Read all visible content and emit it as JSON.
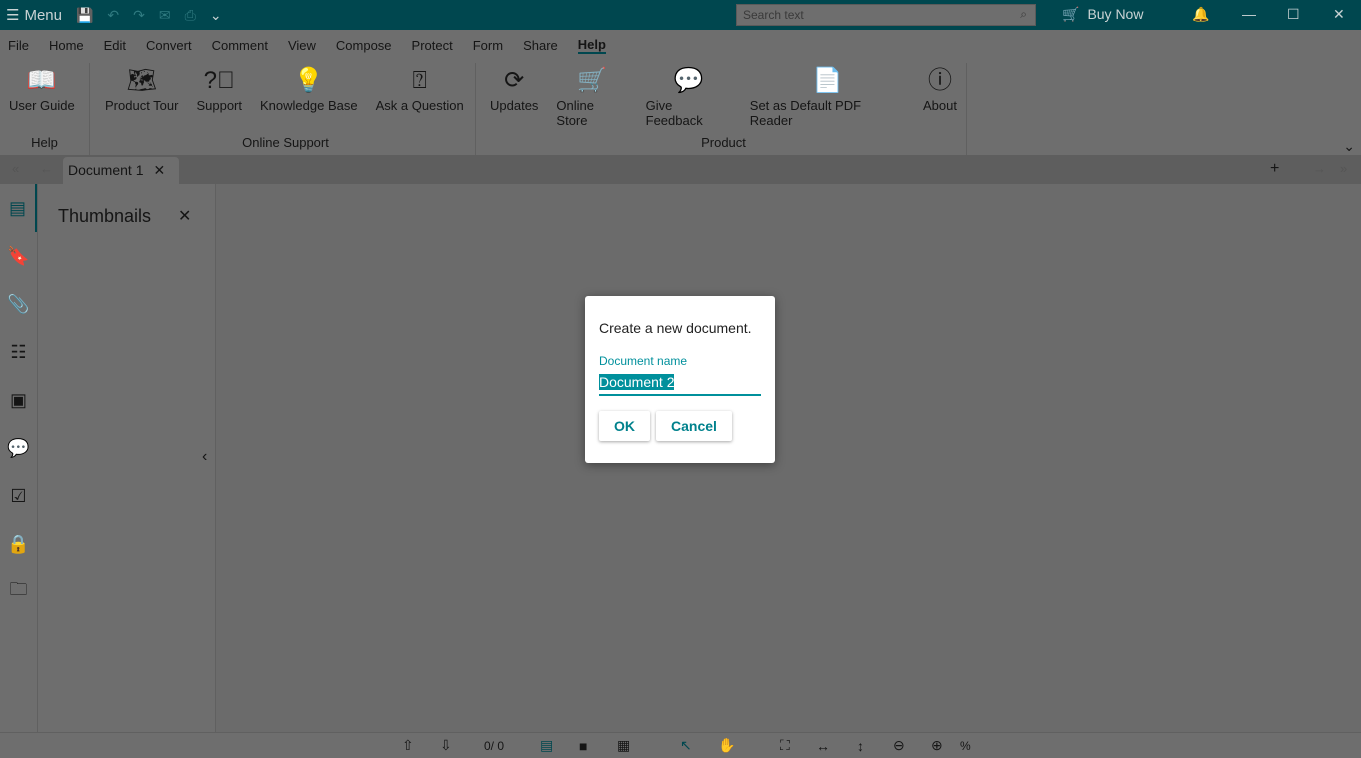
{
  "titlebar": {
    "menu": "Menu",
    "search_placeholder": "Search text",
    "buy_now": "Buy Now"
  },
  "menubar": [
    "File",
    "Home",
    "Edit",
    "Convert",
    "Comment",
    "View",
    "Compose",
    "Protect",
    "Form",
    "Share",
    "Help"
  ],
  "ribbon": {
    "groups": [
      {
        "label": "Help",
        "items": [
          {
            "label": "User Guide",
            "icon": "book-icon"
          }
        ]
      },
      {
        "label": "Online Support",
        "items": [
          {
            "label": "Product Tour",
            "icon": "map-icon"
          },
          {
            "label": "Support",
            "icon": "question-bubble-icon"
          },
          {
            "label": "Knowledge Base",
            "icon": "lightbulb-icon"
          },
          {
            "label": "Ask a Question",
            "icon": "question-chat-icon"
          }
        ]
      },
      {
        "label": "Product",
        "items": [
          {
            "label": "Updates",
            "icon": "refresh-icon"
          },
          {
            "label": "Online Store",
            "icon": "cart-icon"
          },
          {
            "label": "Give Feedback",
            "icon": "feedback-icon"
          },
          {
            "label": "Set as Default PDF Reader",
            "icon": "pdf-icon"
          },
          {
            "label": "About",
            "icon": "info-icon"
          }
        ]
      }
    ]
  },
  "tabs": {
    "doc": "Document 1"
  },
  "panel": {
    "title": "Thumbnails"
  },
  "status": {
    "page": "0/ 0",
    "zoom": "%"
  },
  "dialog": {
    "message": "Create a new document.",
    "field_label": "Document name",
    "field_value": "Document 2",
    "ok": "OK",
    "cancel": "Cancel"
  }
}
